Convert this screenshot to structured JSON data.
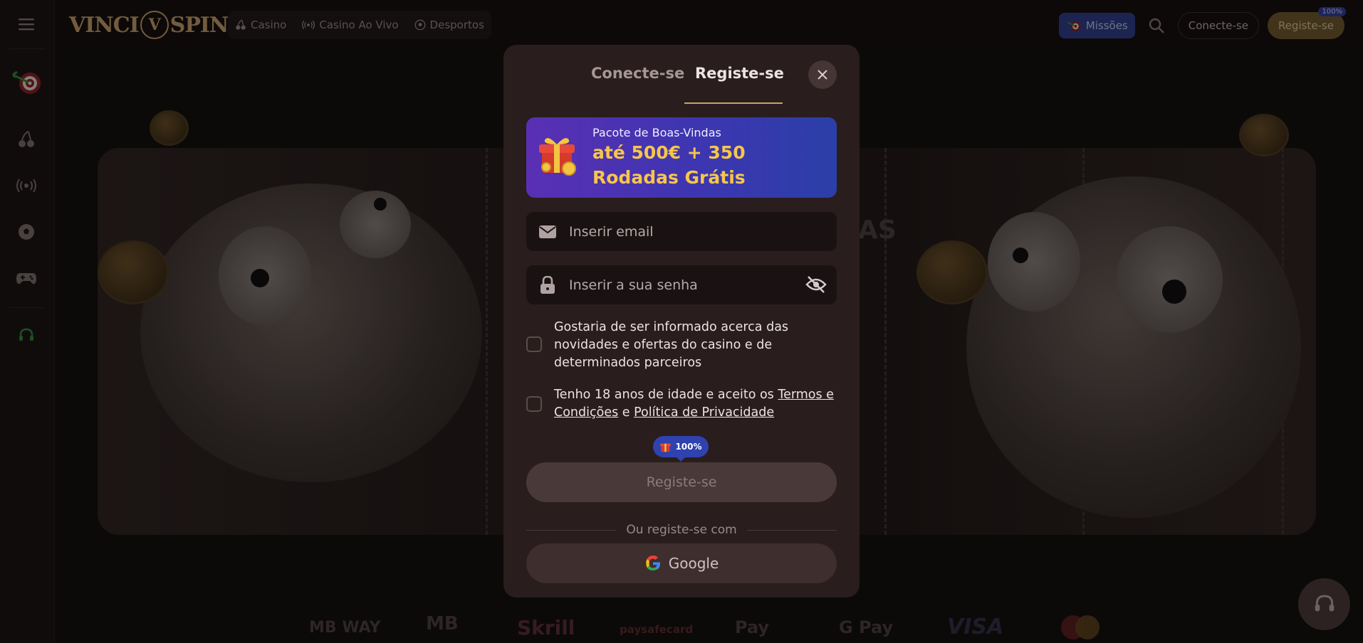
{
  "header": {
    "logo_text_left": "VINCI",
    "logo_mark": "V",
    "logo_text_right": "SPIN",
    "nav": [
      {
        "label": "Casino",
        "icon": "cherry-icon"
      },
      {
        "label": "Casino Ao Vivo",
        "icon": "live-icon"
      },
      {
        "label": "Desportos",
        "icon": "ball-icon"
      }
    ],
    "missions_label": "Missões",
    "login_label": "Conecte-se",
    "register_label": "Registe-se",
    "register_badge": "100%"
  },
  "sidebar": {
    "items": [
      "menu-icon",
      "target-icon",
      "cherry-icon",
      "live-icon",
      "soccer-icon",
      "gamepad-icon",
      "support-icon"
    ]
  },
  "banner": {
    "partial_text": "AS"
  },
  "modal": {
    "tabs": {
      "login": "Conecte-se",
      "register": "Registe-se"
    },
    "active_tab": "register",
    "promo": {
      "subtitle": "Pacote de Boas-Vindas",
      "title": "até 500€ + 350 Rodadas Grátis"
    },
    "email_placeholder": "Inserir email",
    "password_placeholder": "Inserir a sua senha",
    "newsletter_text": "Gostaria de ser informado acerca das novidades e ofertas do casino e de determinados parceiros",
    "terms": {
      "prefix": "Tenho 18 anos de idade e aceito os ",
      "terms_link": "Termos e Condições",
      "middle": " e ",
      "privacy_link": "Política de Privacidade"
    },
    "bonus_badge": "100%",
    "submit_label": "Registe-se",
    "or_text": "Ou registe-se com",
    "google_label": "Google"
  },
  "payments": [
    "MB WAY",
    "MB",
    "Skrill",
    "paysafecard",
    "Pay",
    "G Pay",
    "VISA",
    "mastercard"
  ],
  "colors": {
    "accent_gold": "#c9a36a",
    "promo_gradient_start": "#5a2fb4",
    "promo_gradient_end": "#2b3fa8",
    "promo_title": "#f7c64a",
    "modal_bg": "#2a1d1d"
  }
}
